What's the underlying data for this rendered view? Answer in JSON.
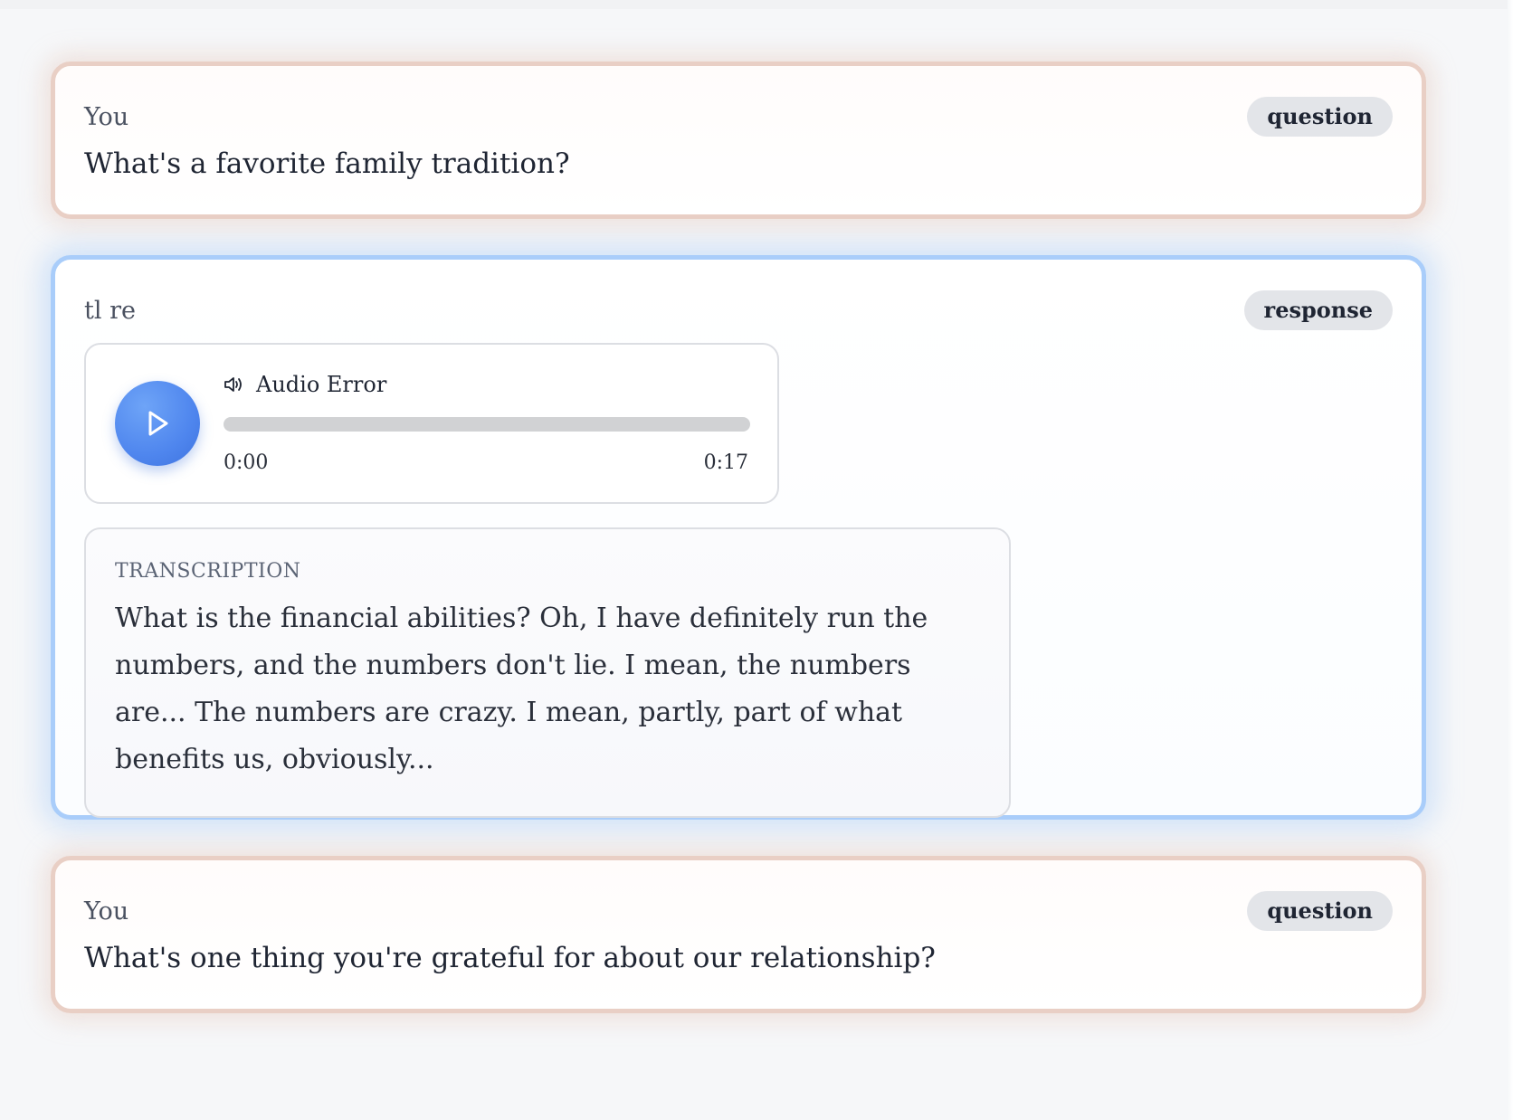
{
  "messages": [
    {
      "speaker": "You",
      "badge": "question",
      "text": "What's a favorite family tradition?"
    },
    {
      "speaker": "tl re",
      "badge": "response",
      "audio": {
        "status": "Audio Error",
        "current_time": "0:00",
        "duration": "0:17",
        "progress": 0
      },
      "transcription_label": "TRANSCRIPTION",
      "transcription": "What is the financial abilities? Oh, I have definitely run the numbers, and the numbers don't lie. I mean, the numbers are... The numbers are crazy. I mean, partly, part of what benefits us, obviously..."
    },
    {
      "speaker": "You",
      "badge": "question",
      "text": "What's one thing you're grateful for about our relationship?"
    }
  ],
  "colors": {
    "question_border": "#e9cfc5",
    "response_border": "#a9cdfa",
    "play_button": "#4f86ee",
    "progress_track": "#d1d2d4"
  },
  "icons": {
    "play": "play-icon",
    "speaker": "speaker-icon"
  }
}
